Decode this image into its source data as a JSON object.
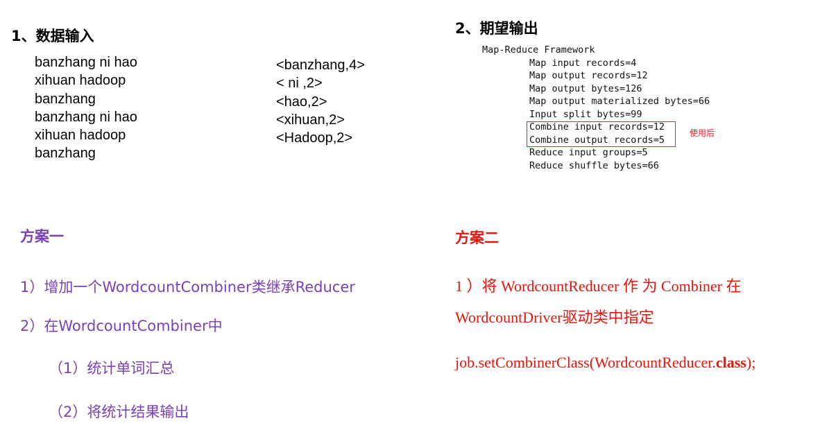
{
  "section1": {
    "title": "1、数据输入",
    "input_lines": [
      "banzhang ni hao",
      "xihuan hadoop",
      "banzhang",
      "banzhang ni hao",
      "xihuan hadoop",
      "banzhang"
    ],
    "output_lines": [
      "<banzhang,4>",
      "< ni ,2>",
      "<hao,2>",
      "<xihuan,2>",
      "<Hadoop,2>"
    ]
  },
  "section2": {
    "title": "2、期望输出",
    "framework_header": "Map-Reduce Framework",
    "counters": [
      "Map input records=4",
      "Map output records=12",
      "Map output bytes=126",
      "Map output materialized bytes=66",
      "Input split bytes=99",
      "Combine input records=12",
      "Combine output records=5",
      "Reduce input groups=5",
      "Reduce shuffle bytes=66"
    ],
    "note": "使用后"
  },
  "plan1": {
    "title": "方案一",
    "step1": "1）增加一个WordcountCombiner类继承Reducer",
    "step2": "2）在WordcountCombiner中",
    "sub1": "（1）统计单词汇总",
    "sub2": "（2）将统计结果输出"
  },
  "plan2": {
    "title": "方案二",
    "line1": "1 ）将 WordcountReducer 作 为 Combiner 在",
    "line2": "WordcountDriver驱动类中指定",
    "code_prefix": "job.setCombinerClass(WordcountReducer.",
    "code_keyword": "class",
    "code_suffix": ");"
  },
  "colors": {
    "purple": "#7a3fb8",
    "red": "#e8140c",
    "box_red": "#e0262b"
  }
}
